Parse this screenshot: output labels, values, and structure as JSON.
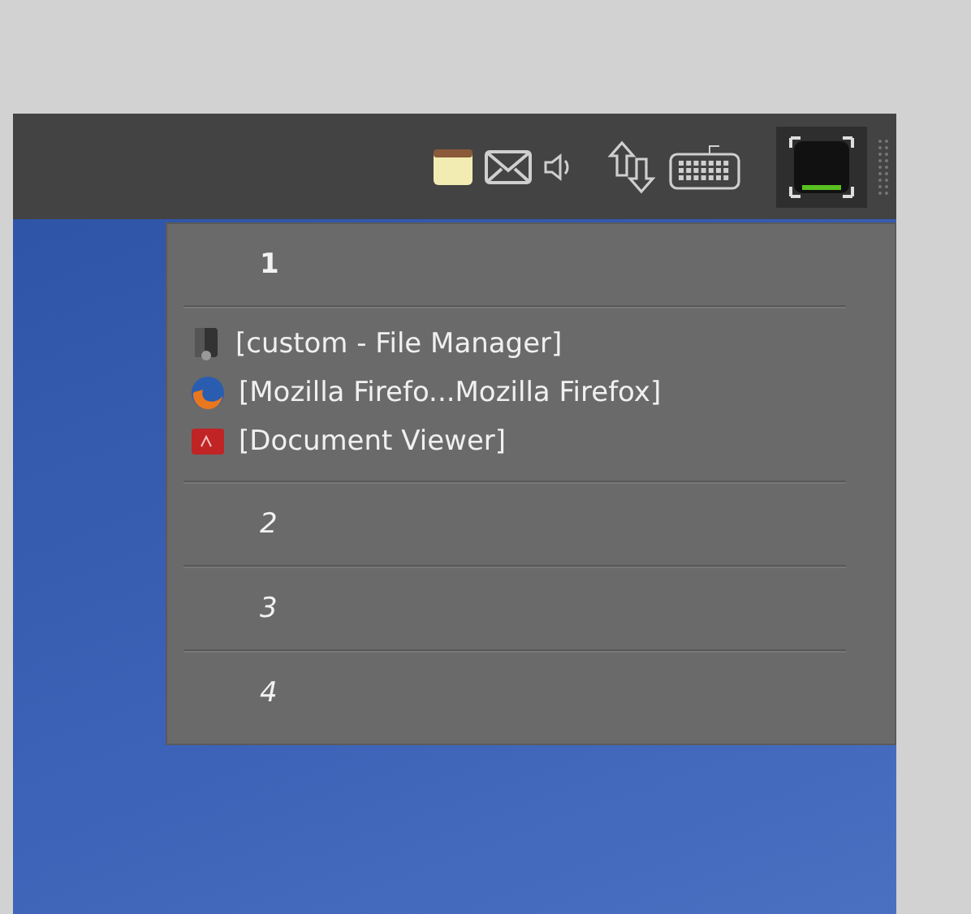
{
  "workspace_menu": {
    "workspaces": [
      {
        "label": "1",
        "current": true,
        "windows": [
          {
            "title": "[custom - File Manager]",
            "kind": "file-manager"
          },
          {
            "title": "[Mozilla Firefo...Mozilla Firefox]",
            "kind": "browser"
          },
          {
            "title": "[Document Viewer]",
            "kind": "document"
          }
        ]
      },
      {
        "label": "2",
        "current": false
      },
      {
        "label": "3",
        "current": false
      },
      {
        "label": "4",
        "current": false
      }
    ]
  }
}
